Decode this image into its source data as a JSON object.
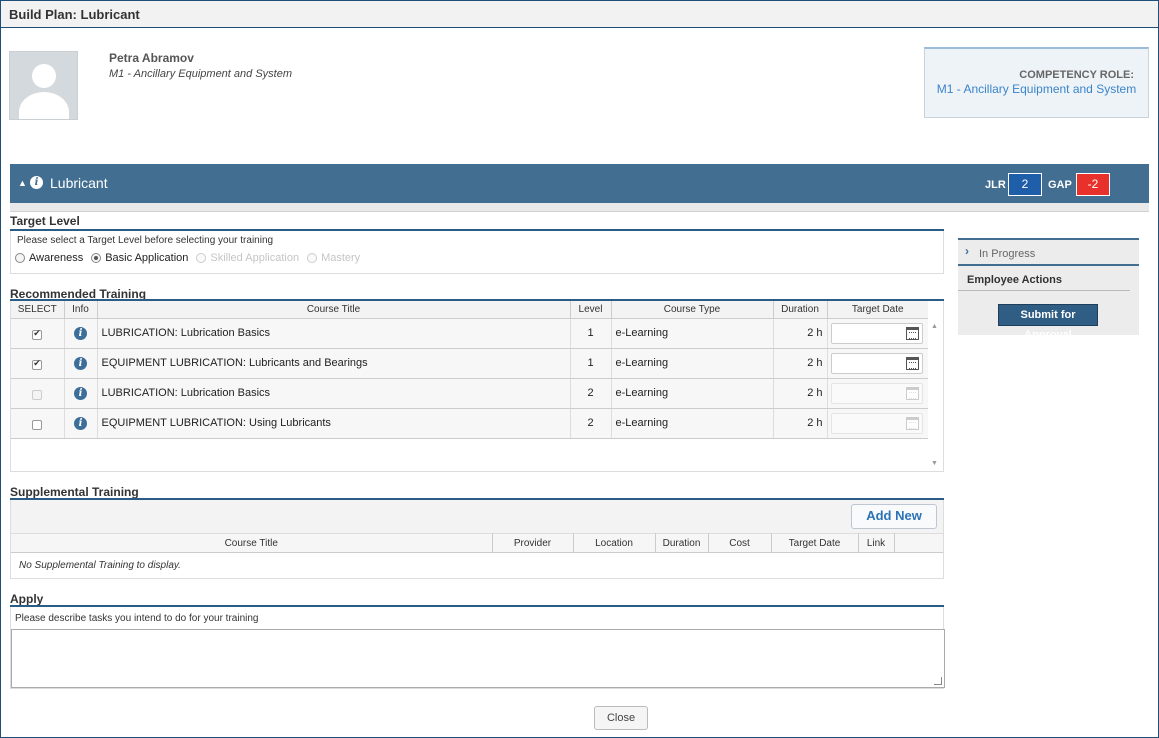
{
  "window": {
    "title": "Build Plan: Lubricant"
  },
  "user": {
    "name": "Petra Abramov",
    "role": "M1 - Ancillary Equipment and System"
  },
  "competency": {
    "label": "COMPETENCY ROLE:",
    "value": "M1 - Ancillary Equipment and System"
  },
  "section": {
    "title": "Lubricant",
    "jlr_label": "JLR",
    "jlr_value": "2",
    "gap_label": "GAP",
    "gap_value": "-2"
  },
  "target_level": {
    "heading": "Target Level",
    "hint": "Please select a Target Level before selecting your training",
    "options": [
      {
        "label": "Awareness",
        "state": "enabled"
      },
      {
        "label": "Basic Application",
        "state": "selected"
      },
      {
        "label": "Skilled Application",
        "state": "disabled"
      },
      {
        "label": "Mastery",
        "state": "disabled"
      }
    ]
  },
  "recommended": {
    "heading": "Recommended Training",
    "columns": [
      "SELECT",
      "Info",
      "Course Title",
      "Level",
      "Course Type",
      "Duration",
      "Target Date"
    ],
    "rows": [
      {
        "checked": true,
        "enabled": true,
        "title": "LUBRICATION: Lubrication Basics",
        "level": "1",
        "type": "e-Learning",
        "duration": "2 h"
      },
      {
        "checked": true,
        "enabled": true,
        "title": "EQUIPMENT LUBRICATION: Lubricants and Bearings",
        "level": "1",
        "type": "e-Learning",
        "duration": "2 h"
      },
      {
        "checked": false,
        "enabled": false,
        "title": "LUBRICATION: Lubrication Basics",
        "level": "2",
        "type": "e-Learning",
        "duration": "2 h"
      },
      {
        "checked": false,
        "enabled": true,
        "title": "EQUIPMENT LUBRICATION: Using Lubricants",
        "level": "2",
        "type": "e-Learning",
        "duration": "2 h"
      }
    ]
  },
  "supplemental": {
    "heading": "Supplemental Training",
    "add_label": "Add New",
    "columns": [
      "Course Title",
      "Provider",
      "Location",
      "Duration",
      "Cost",
      "Target Date",
      "Link",
      ""
    ],
    "empty": "No Supplemental Training to display."
  },
  "apply": {
    "heading": "Apply",
    "hint": "Please describe tasks you intend to do for your training",
    "value": ""
  },
  "side": {
    "progress": "In Progress",
    "actions": "Employee Actions",
    "submit": "Submit for Approval"
  },
  "footer": {
    "close": "Close"
  },
  "colors": {
    "header_bar": "#416e91",
    "jlr": "#1f5ea8",
    "gap": "#e8312a",
    "link": "#3b84c8"
  }
}
